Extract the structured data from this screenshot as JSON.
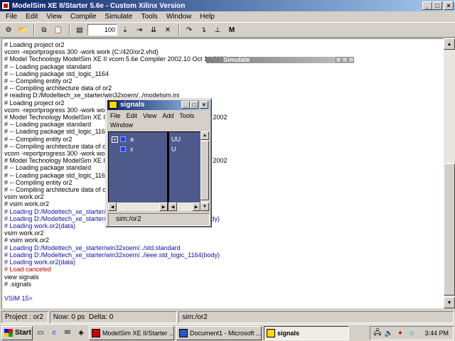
{
  "window": {
    "title": "ModelSim XE II/Starter 5.6e - Custom Xilinx Version"
  },
  "menu": [
    "File",
    "Edit",
    "View",
    "Compile",
    "Simulate",
    "Tools",
    "Window",
    "Help"
  ],
  "toolbar": {
    "run_length": "100"
  },
  "transcript": [
    {
      "text": "# Loading project or2",
      "style": "black"
    },
    {
      "text": "vcom -reportprogress 300 -work work {C:/420/or2.vhd}",
      "style": "black"
    },
    {
      "text": "# Model Technology ModelSim XE II vcom 5.6e Compiler 2002.10 Oct 14 2002",
      "style": "black"
    },
    {
      "text": "# -- Loading package standard",
      "style": "black"
    },
    {
      "text": "# -- Loading package std_logic_1164",
      "style": "black"
    },
    {
      "text": "# -- Compiling entity or2",
      "style": "black"
    },
    {
      "text": "# -- Compiling architecture data of or2",
      "style": "black"
    },
    {
      "text": "# reading D:/Modeltech_xe_starter/win32xoem/../modelsim.ini",
      "style": "black"
    },
    {
      "text": "# Loading project or2",
      "style": "black"
    },
    {
      "text": "vcom -reportprogress 300 -work work {C:/420/or2.vhd}",
      "style": "black"
    },
    {
      "text": "# Model Technology ModelSim XE II vcom 5.6e Compiler 2002.10 Oct 14 2002",
      "style": "black"
    },
    {
      "text": "# -- Loading package standard",
      "style": "black"
    },
    {
      "text": "# -- Loading package std_logic_1164",
      "style": "black"
    },
    {
      "text": "# -- Compiling entity or2",
      "style": "black"
    },
    {
      "text": "# -- Compiling architecture data of or2",
      "style": "black"
    },
    {
      "text": "vcom -reportprogress 300 -work work {C:/420/or2.vhd}",
      "style": "black"
    },
    {
      "text": "# Model Technology ModelSim XE II vcom 5.6e Compiler 2002.10 Oct 14 2002",
      "style": "black"
    },
    {
      "text": "# -- Loading package standard",
      "style": "black"
    },
    {
      "text": "# -- Loading package std_logic_1164",
      "style": "black"
    },
    {
      "text": "# -- Compiling entity or2",
      "style": "black"
    },
    {
      "text": "# -- Compiling architecture data of or2",
      "style": "black"
    },
    {
      "text": "vsim work.or2",
      "style": "black"
    },
    {
      "text": "# vsim work.or2",
      "style": "black"
    },
    {
      "text": "# Loading D:/Modeltech_xe_starter/win32xoem/../std.standard",
      "style": "blue"
    },
    {
      "text": "# Loading D:/Modeltech_xe_starter/win32xoem/../ieee.std_logic_1164(body)",
      "style": "blue"
    },
    {
      "text": "# Loading work.or2(data)",
      "style": "blue"
    },
    {
      "text": "vsim work.or2",
      "style": "black"
    },
    {
      "text": "# vsim work.or2",
      "style": "black"
    },
    {
      "text": "# Loading D:/Modeltech_xe_starter/win32xoem/../std.standard",
      "style": "blue"
    },
    {
      "text": "# Loading D:/Modeltech_xe_starter/win32xoem/../ieee.std_logic_1164(body)",
      "style": "blue"
    },
    {
      "text": "# Loading work.or2(data)",
      "style": "blue"
    },
    {
      "text": "# Load canceled",
      "style": "red"
    },
    {
      "text": "view signals",
      "style": "black"
    },
    {
      "text": "# .signals",
      "style": "black"
    },
    {
      "text": "",
      "style": "black"
    },
    {
      "text": "VSIM 15>",
      "style": "blue"
    }
  ],
  "status": {
    "project": "Project : or2",
    "now": "Now: 0 ps",
    "delta": "Delta: 0",
    "context": "sim:/or2"
  },
  "simulate_dialog": {
    "title": "Simulate"
  },
  "signals": {
    "title": "signals",
    "menu_row1": [
      "File",
      "Edit",
      "View",
      "Add",
      "Tools"
    ],
    "menu_row2": [
      "Window"
    ],
    "rows": [
      {
        "name": "a",
        "value": "UU",
        "expandable": true
      },
      {
        "name": "x",
        "value": "U",
        "expandable": false
      }
    ],
    "status": "sim:/or2"
  },
  "taskbar": {
    "start": "Start",
    "tasks": [
      {
        "label": "ModelSim XE II/Starter ...",
        "active": false
      },
      {
        "label": "Document1 - Microsoft ...",
        "active": false
      },
      {
        "label": "signals",
        "active": true
      }
    ],
    "clock": "3:44 PM"
  }
}
